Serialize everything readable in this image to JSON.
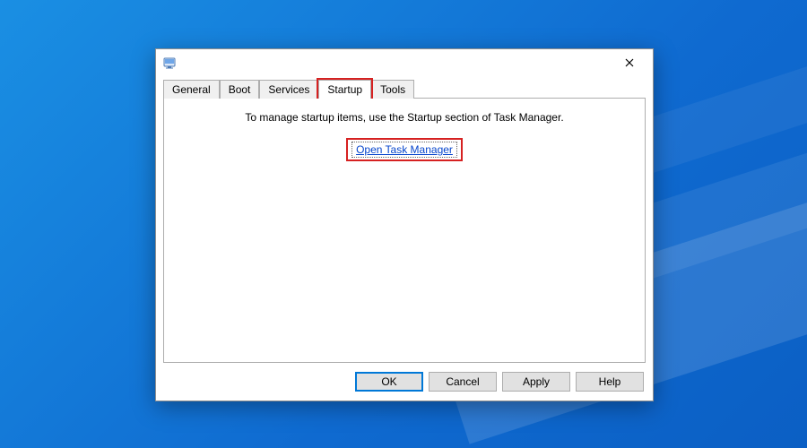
{
  "tabs": {
    "general": "General",
    "boot": "Boot",
    "services": "Services",
    "startup": "Startup",
    "tools": "Tools"
  },
  "active_tab": "startup",
  "content": {
    "instructions": "To manage startup items, use the Startup section of Task Manager.",
    "link_text": "Open Task Manager"
  },
  "buttons": {
    "ok": "OK",
    "cancel": "Cancel",
    "apply": "Apply",
    "help": "Help"
  },
  "highlight_color": "#d62121"
}
